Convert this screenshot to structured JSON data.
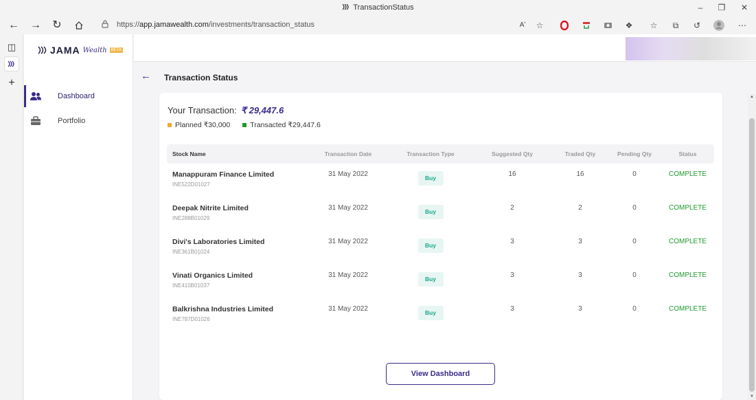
{
  "browser": {
    "tab_title": "TransactionStatus",
    "url_prefix": "https://",
    "url_host": "app.jamawealth.com",
    "url_path": "/investments/transaction_status",
    "read_aloud_label": "Aʹ",
    "icons": [
      "back-icon",
      "forward-icon",
      "refresh-icon",
      "home-icon",
      "lock-icon",
      "read-aloud-icon",
      "favorite-icon",
      "opera-icon",
      "extension-icon",
      "camera-icon",
      "puzzle-icon",
      "favorites-bar-icon",
      "collections-icon",
      "history-icon",
      "profile-icon",
      "more-icon"
    ]
  },
  "sidebar": {
    "brand": "JAMA",
    "brand_sub": "Wealth",
    "beta": "BETA",
    "items": [
      {
        "label": "Dashboard",
        "icon": "users-icon",
        "active": true
      },
      {
        "label": "Portfolio",
        "icon": "briefcase-icon",
        "active": false
      }
    ]
  },
  "header": {
    "title": "Transaction Status"
  },
  "summary": {
    "label": "Your Transaction:",
    "amount": "₹ 29,447.6",
    "planned_label": "Planned ₹30,000",
    "transacted_label": "Transacted ₹29,447.6",
    "planned_color": "#f0a830",
    "transacted_color": "#1c9a2c"
  },
  "table": {
    "headers": [
      "Stock Name",
      "Transaction Date",
      "Transaction Type",
      "Suggested Qty",
      "Traded Qty",
      "Pending Qty",
      "Status"
    ],
    "rows": [
      {
        "name": "Manappuram Finance Limited",
        "isin": "INE522D01027",
        "date": "31 May 2022",
        "type": "Buy",
        "suggested": "16",
        "traded": "16",
        "pending": "0",
        "status": "COMPLETE"
      },
      {
        "name": "Deepak Nitrite Limited",
        "isin": "INE288B01029",
        "date": "31 May 2022",
        "type": "Buy",
        "suggested": "2",
        "traded": "2",
        "pending": "0",
        "status": "COMPLETE"
      },
      {
        "name": "Divi's Laboratories Limited",
        "isin": "INE361B01024",
        "date": "31 May 2022",
        "type": "Buy",
        "suggested": "3",
        "traded": "3",
        "pending": "0",
        "status": "COMPLETE"
      },
      {
        "name": "Vinati Organics Limited",
        "isin": "INE410B01037",
        "date": "31 May 2022",
        "type": "Buy",
        "suggested": "3",
        "traded": "3",
        "pending": "0",
        "status": "COMPLETE"
      },
      {
        "name": "Balkrishna Industries Limited",
        "isin": "INE787D01026",
        "date": "31 May 2022",
        "type": "Buy",
        "suggested": "3",
        "traded": "3",
        "pending": "0",
        "status": "COMPLETE"
      }
    ]
  },
  "actions": {
    "view_dashboard": "View Dashboard"
  },
  "colors": {
    "accent": "#3b2a8a",
    "success": "#1c9a2c",
    "buy_chip_bg": "#e8f6f3",
    "buy_chip_text": "#1aa88a"
  }
}
